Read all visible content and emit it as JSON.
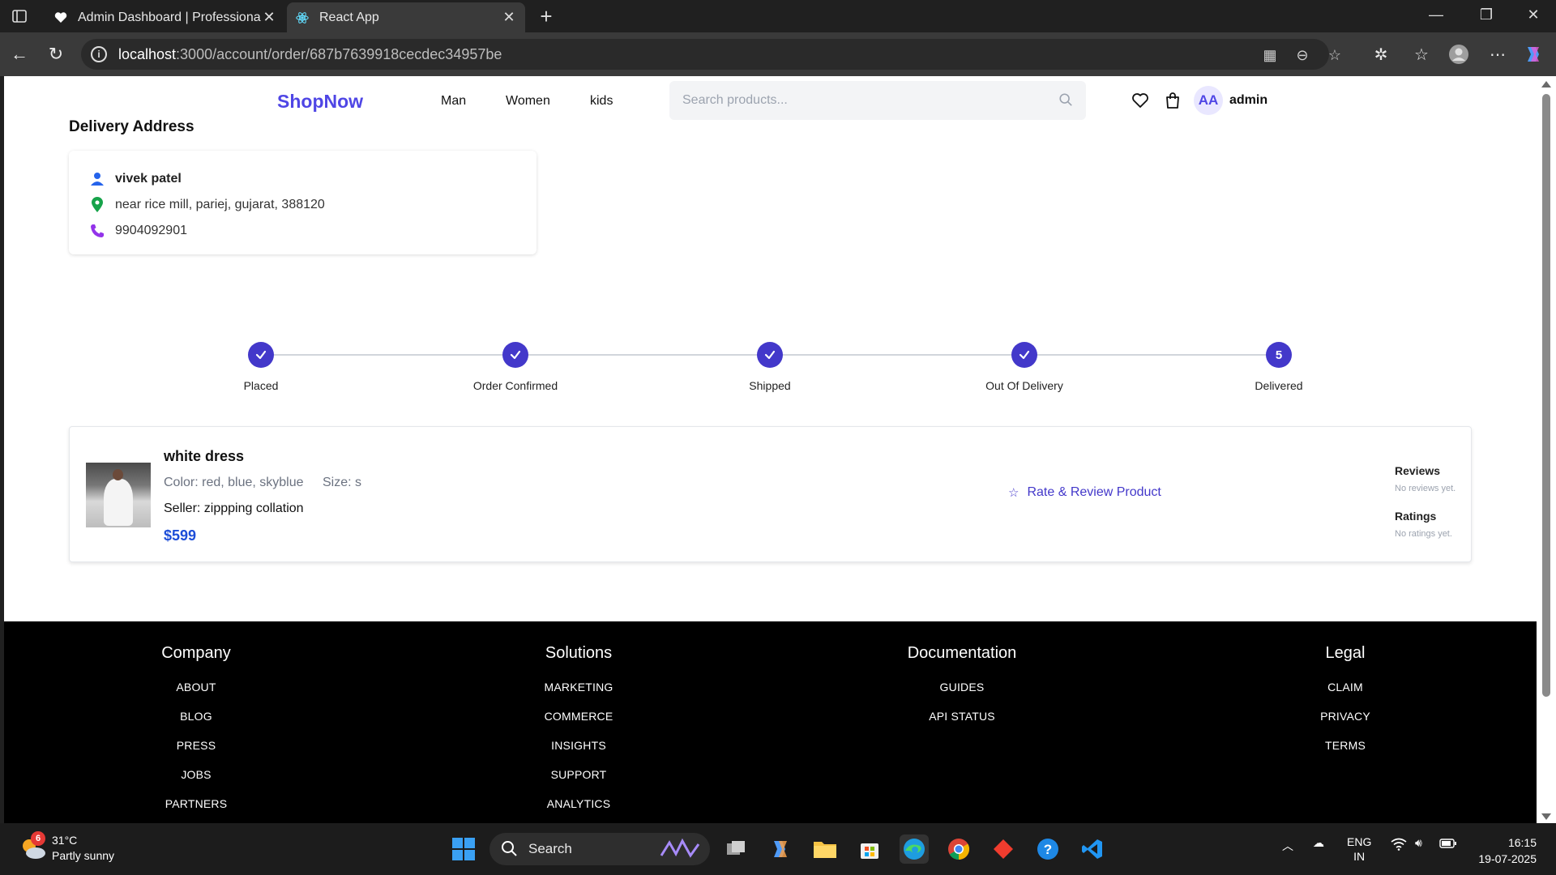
{
  "browser": {
    "tabs": [
      {
        "title": "Admin Dashboard | Professional M",
        "active": false
      },
      {
        "title": "React App",
        "active": true
      }
    ],
    "url_host": "localhost",
    "url_path": ":3000/account/order/687b7639918cecdec34957be"
  },
  "header": {
    "logo": "ShopNow",
    "nav": [
      "Man",
      "Women",
      "kids"
    ],
    "search_placeholder": "Search products...",
    "avatar_initials": "AA",
    "username": "admin"
  },
  "delivery": {
    "title": "Delivery Address",
    "name": "vivek patel",
    "address": "near rice mill, pariej, gujarat, 388120",
    "phone": "9904092901"
  },
  "steps": [
    {
      "label": "Placed",
      "done": true
    },
    {
      "label": "Order Confirmed",
      "done": true
    },
    {
      "label": "Shipped",
      "done": true
    },
    {
      "label": "Out Of Delivery",
      "done": true
    },
    {
      "label": "Delivered",
      "done": false,
      "number": "5"
    }
  ],
  "order_item": {
    "name": "white dress",
    "color": "Color: red, blue, skyblue",
    "size": "Size: s",
    "seller": "Seller: zippping collation",
    "price": "$599",
    "review_button": "Rate & Review Product",
    "reviews_heading": "Reviews",
    "reviews_text": "No reviews yet.",
    "ratings_heading": "Ratings",
    "ratings_text": "No ratings yet."
  },
  "footer": {
    "columns": [
      {
        "heading": "Company",
        "links": [
          "ABOUT",
          "BLOG",
          "PRESS",
          "JOBS",
          "PARTNERS"
        ]
      },
      {
        "heading": "Solutions",
        "links": [
          "MARKETING",
          "COMMERCE",
          "INSIGHTS",
          "SUPPORT",
          "ANALYTICS"
        ]
      },
      {
        "heading": "Documentation",
        "links": [
          "GUIDES",
          "API STATUS"
        ]
      },
      {
        "heading": "Legal",
        "links": [
          "CLAIM",
          "PRIVACY",
          "TERMS"
        ]
      }
    ]
  },
  "taskbar": {
    "weather_badge": "6",
    "temperature": "31°C",
    "condition": "Partly sunny",
    "search_label": "Search",
    "lang_1": "ENG",
    "lang_2": "IN",
    "time": "16:15",
    "date": "19-07-2025"
  },
  "colors": {
    "brand": "#4f46e5",
    "step_active": "#4338ca",
    "price": "#1d4ed8",
    "footer_bg": "#000000"
  }
}
